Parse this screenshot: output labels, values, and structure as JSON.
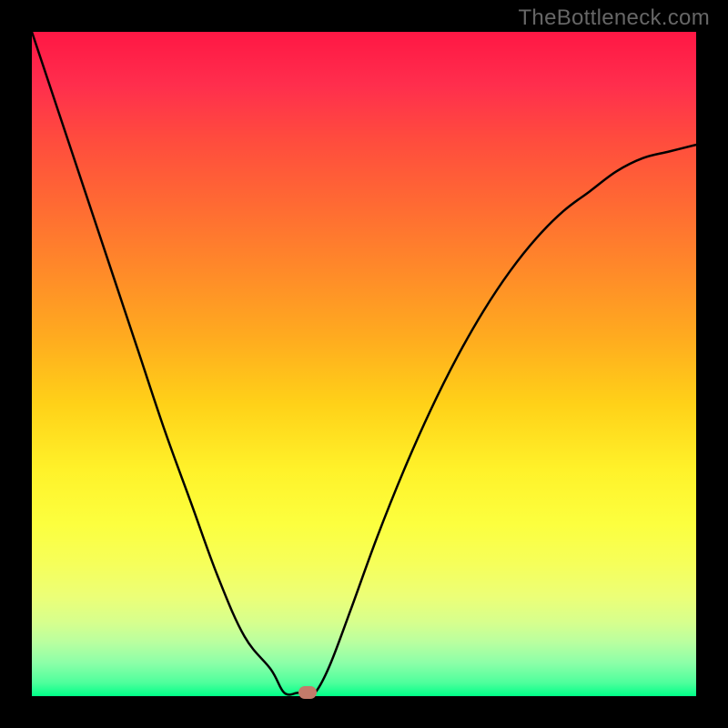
{
  "watermark": "TheBottleneck.com",
  "chart_data": {
    "type": "line",
    "title": "",
    "xlabel": "",
    "ylabel": "",
    "x": [
      0.0,
      0.04,
      0.08,
      0.12,
      0.16,
      0.2,
      0.24,
      0.28,
      0.32,
      0.36,
      0.38,
      0.4,
      0.41,
      0.42,
      0.43,
      0.45,
      0.48,
      0.52,
      0.56,
      0.6,
      0.64,
      0.68,
      0.72,
      0.76,
      0.8,
      0.84,
      0.88,
      0.92,
      0.96,
      1.0
    ],
    "values": [
      1.0,
      0.88,
      0.76,
      0.64,
      0.52,
      0.4,
      0.29,
      0.18,
      0.09,
      0.04,
      0.005,
      0.005,
      0.005,
      0.005,
      0.01,
      0.05,
      0.13,
      0.24,
      0.34,
      0.43,
      0.51,
      0.58,
      0.64,
      0.69,
      0.73,
      0.76,
      0.79,
      0.81,
      0.82,
      0.83
    ],
    "xlim": [
      0,
      1
    ],
    "ylim": [
      0,
      1
    ],
    "grid": false,
    "marker": {
      "x": 0.415,
      "y": 0.005,
      "color": "#c37b6a"
    },
    "legend_position": "none",
    "annotations": []
  },
  "colors": {
    "frame": "#000000",
    "curve": "#000000",
    "marker": "#c37b6a",
    "watermark": "#666666"
  }
}
